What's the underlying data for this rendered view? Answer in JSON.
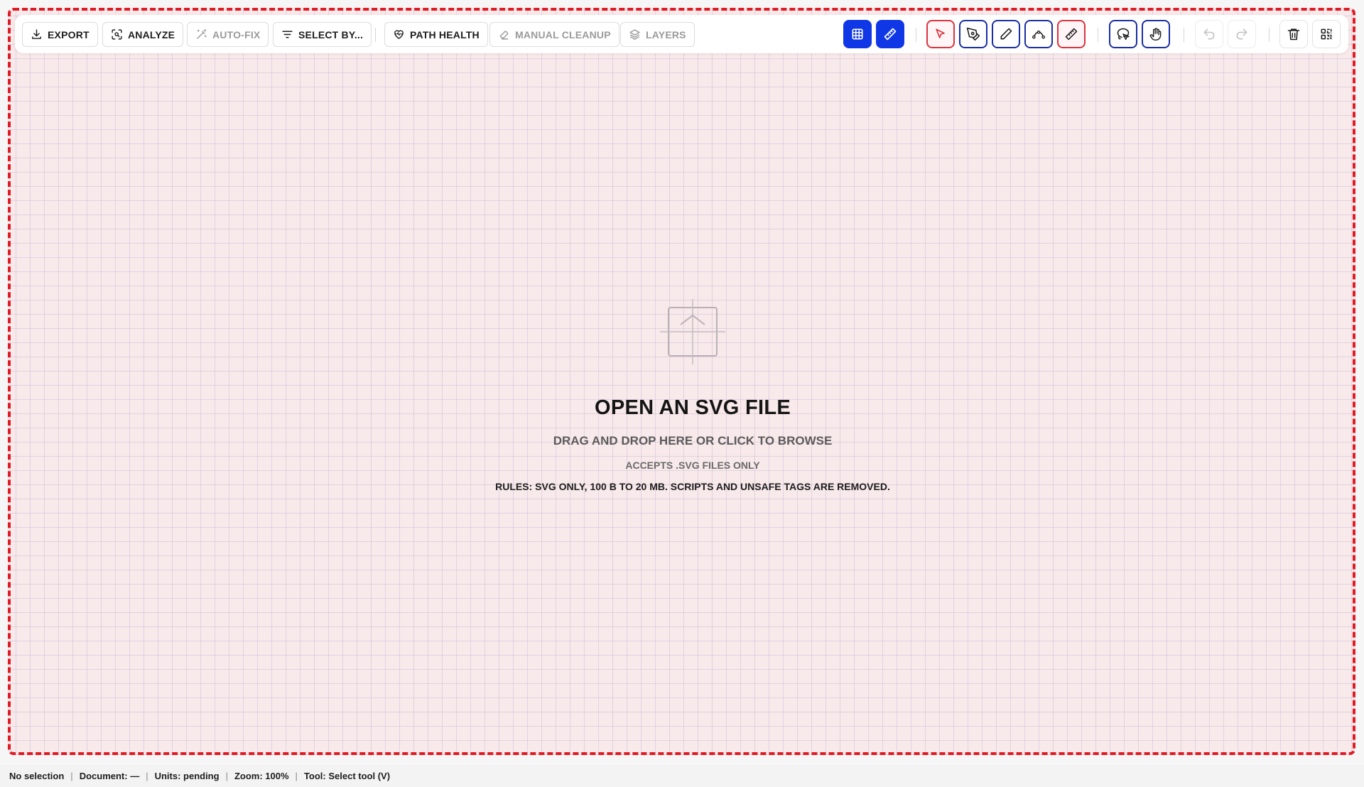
{
  "toolbar": {
    "export_label": "EXPORT",
    "analyze_label": "ANALYZE",
    "autofix_label": "AUTO-FIX",
    "select_by_label": "SELECT BY...",
    "path_health_label": "PATH HEALTH",
    "manual_cleanup_label": "MANUAL CLEANUP",
    "layers_label": "LAYERS",
    "icons": [
      "grid-icon",
      "ruler-icon",
      "pointer-icon",
      "pen-icon",
      "pencil-icon",
      "node-edit-icon",
      "measure-icon",
      "lasso-icon",
      "hand-icon",
      "undo-icon",
      "redo-icon",
      "trash-icon",
      "qr-scan-icon"
    ]
  },
  "dropzone": {
    "title": "OPEN AN SVG FILE",
    "subtitle": "DRAG AND DROP HERE OR CLICK TO BROWSE",
    "accepts": "ACCEPTS .SVG FILES ONLY",
    "rules": "RULES: SVG ONLY, 100 B TO 20 MB. SCRIPTS AND UNSAFE TAGS ARE REMOVED."
  },
  "status": {
    "selection": "No selection",
    "document": "Document: —",
    "units": "Units: pending",
    "zoom": "Zoom: 100%",
    "tool": "Tool: Select tool (V)",
    "divider": "|"
  },
  "colors": {
    "accent_blue": "#1037e6",
    "drop_border_red": "#e01b24",
    "canvas_pink": "#f8e9ea"
  }
}
